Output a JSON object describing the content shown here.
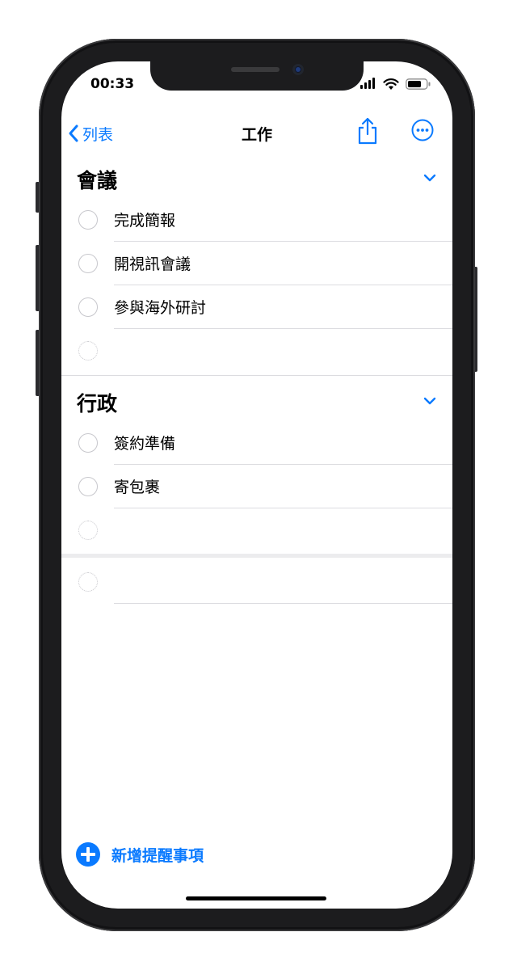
{
  "status_bar": {
    "time": "00:33"
  },
  "nav": {
    "back_label": "列表",
    "title": "工作"
  },
  "sections": [
    {
      "title": "會議",
      "items": [
        "完成簡報",
        "開視訊會議",
        "參與海外研討"
      ]
    },
    {
      "title": "行政",
      "items": [
        "簽約準備",
        "寄包裹"
      ]
    }
  ],
  "footer": {
    "add_label": "新增提醒事項"
  },
  "colors": {
    "accent": "#0a7aff",
    "separator": "#dcdce0",
    "circle": "#c7c7cc"
  }
}
